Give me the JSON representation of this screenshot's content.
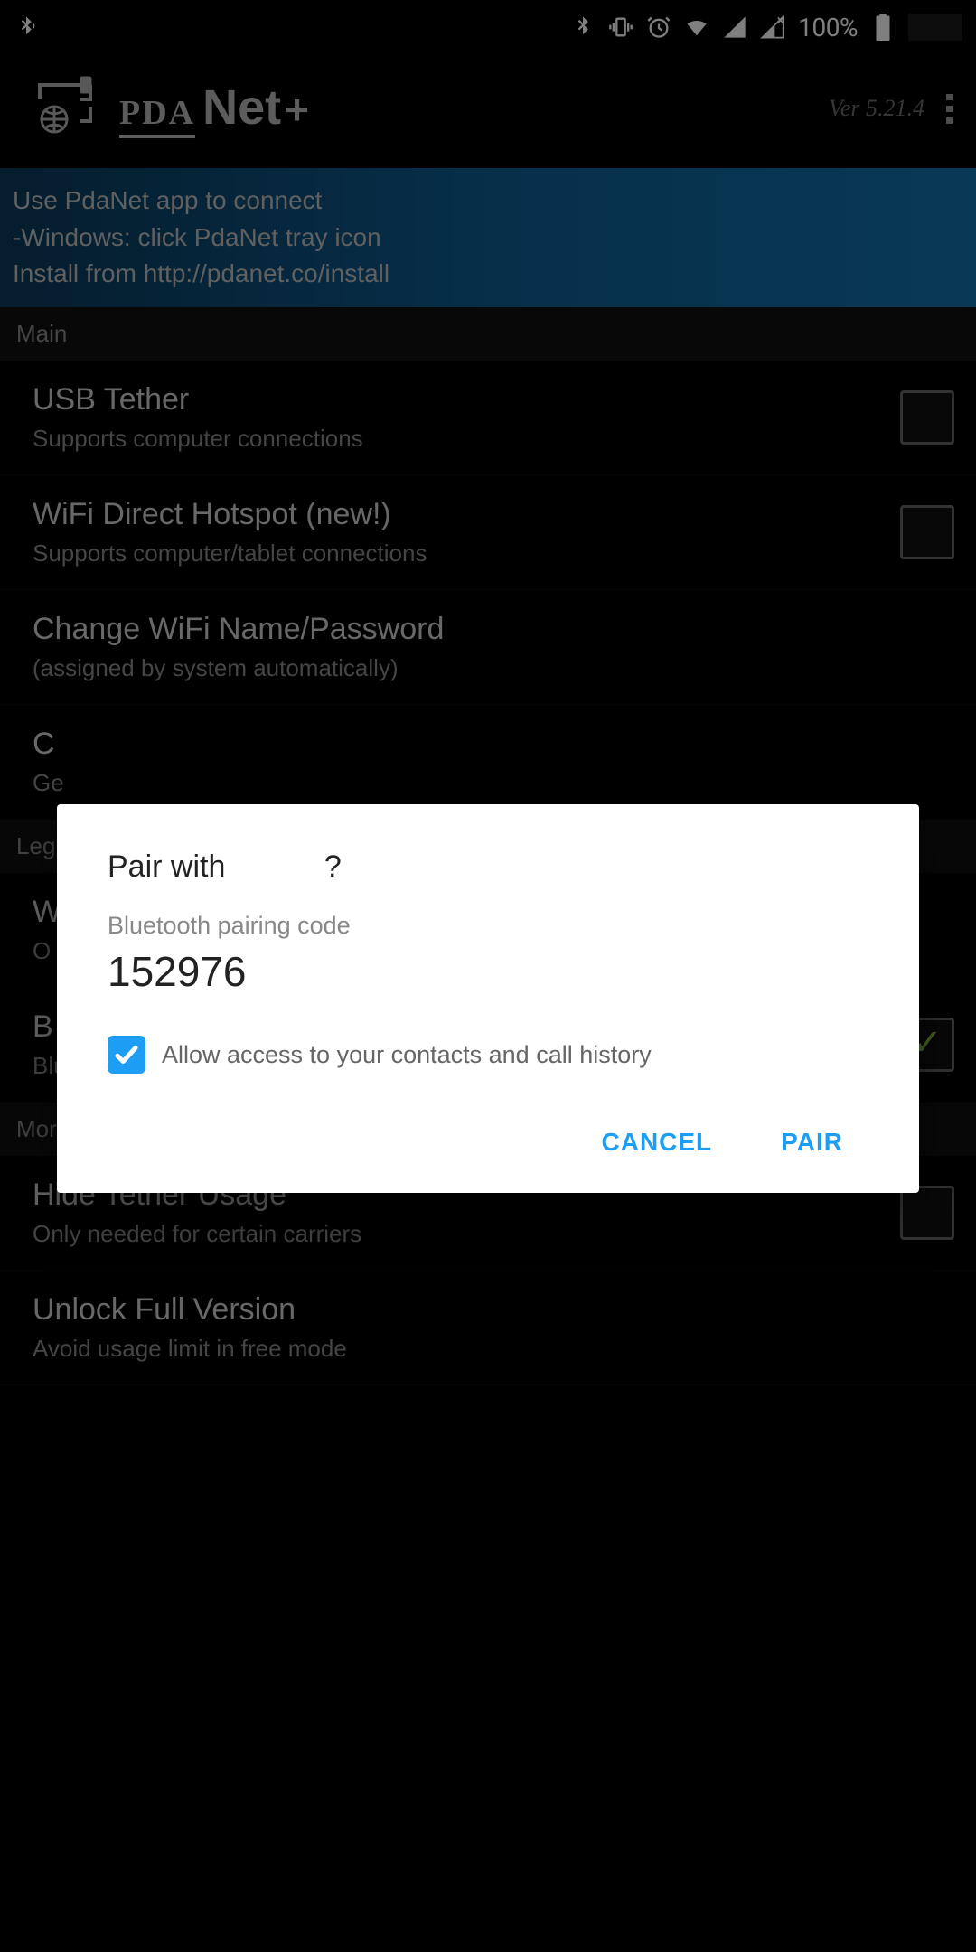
{
  "status": {
    "battery_pct": "100%"
  },
  "header": {
    "app_pda": "PDA",
    "app_net": "Net",
    "app_plus": "+",
    "version": "Ver 5.21.4"
  },
  "banner": {
    "line1": "Use PdaNet app to connect",
    "line2": "-Windows: click PdaNet tray icon",
    "line3": "Install from http://pdanet.co/install"
  },
  "sections": {
    "main": "Main",
    "legacy": "Leg",
    "more": "More"
  },
  "items": {
    "usb_title": "USB Tether",
    "usb_sub": "Supports computer connections",
    "wifi_title": "WiFi Direct Hotspot (new!)",
    "wifi_sub": "Supports computer/tablet connections",
    "changewifi_title": "Change WiFi Name/Password",
    "changewifi_sub": "(assigned by system automatically)",
    "conn_title": "C",
    "conn_sub": "Ge",
    "wpart_title": "W",
    "wpart_sub": "O",
    "bt_title": "B",
    "bt_sub": "Bluetooth Ready",
    "hide_title": "Hide Tether Usage",
    "hide_sub": "Only needed for certain carriers",
    "unlock_title": "Unlock Full Version",
    "unlock_sub": "Avoid usage limit in free mode"
  },
  "dialog": {
    "title_pre": "Pair with ",
    "title_post": "?",
    "subtitle": "Bluetooth pairing code",
    "code": "152976",
    "checkbox_label": "Allow access to your contacts and call history",
    "cancel": "CANCEL",
    "pair": "PAIR"
  }
}
